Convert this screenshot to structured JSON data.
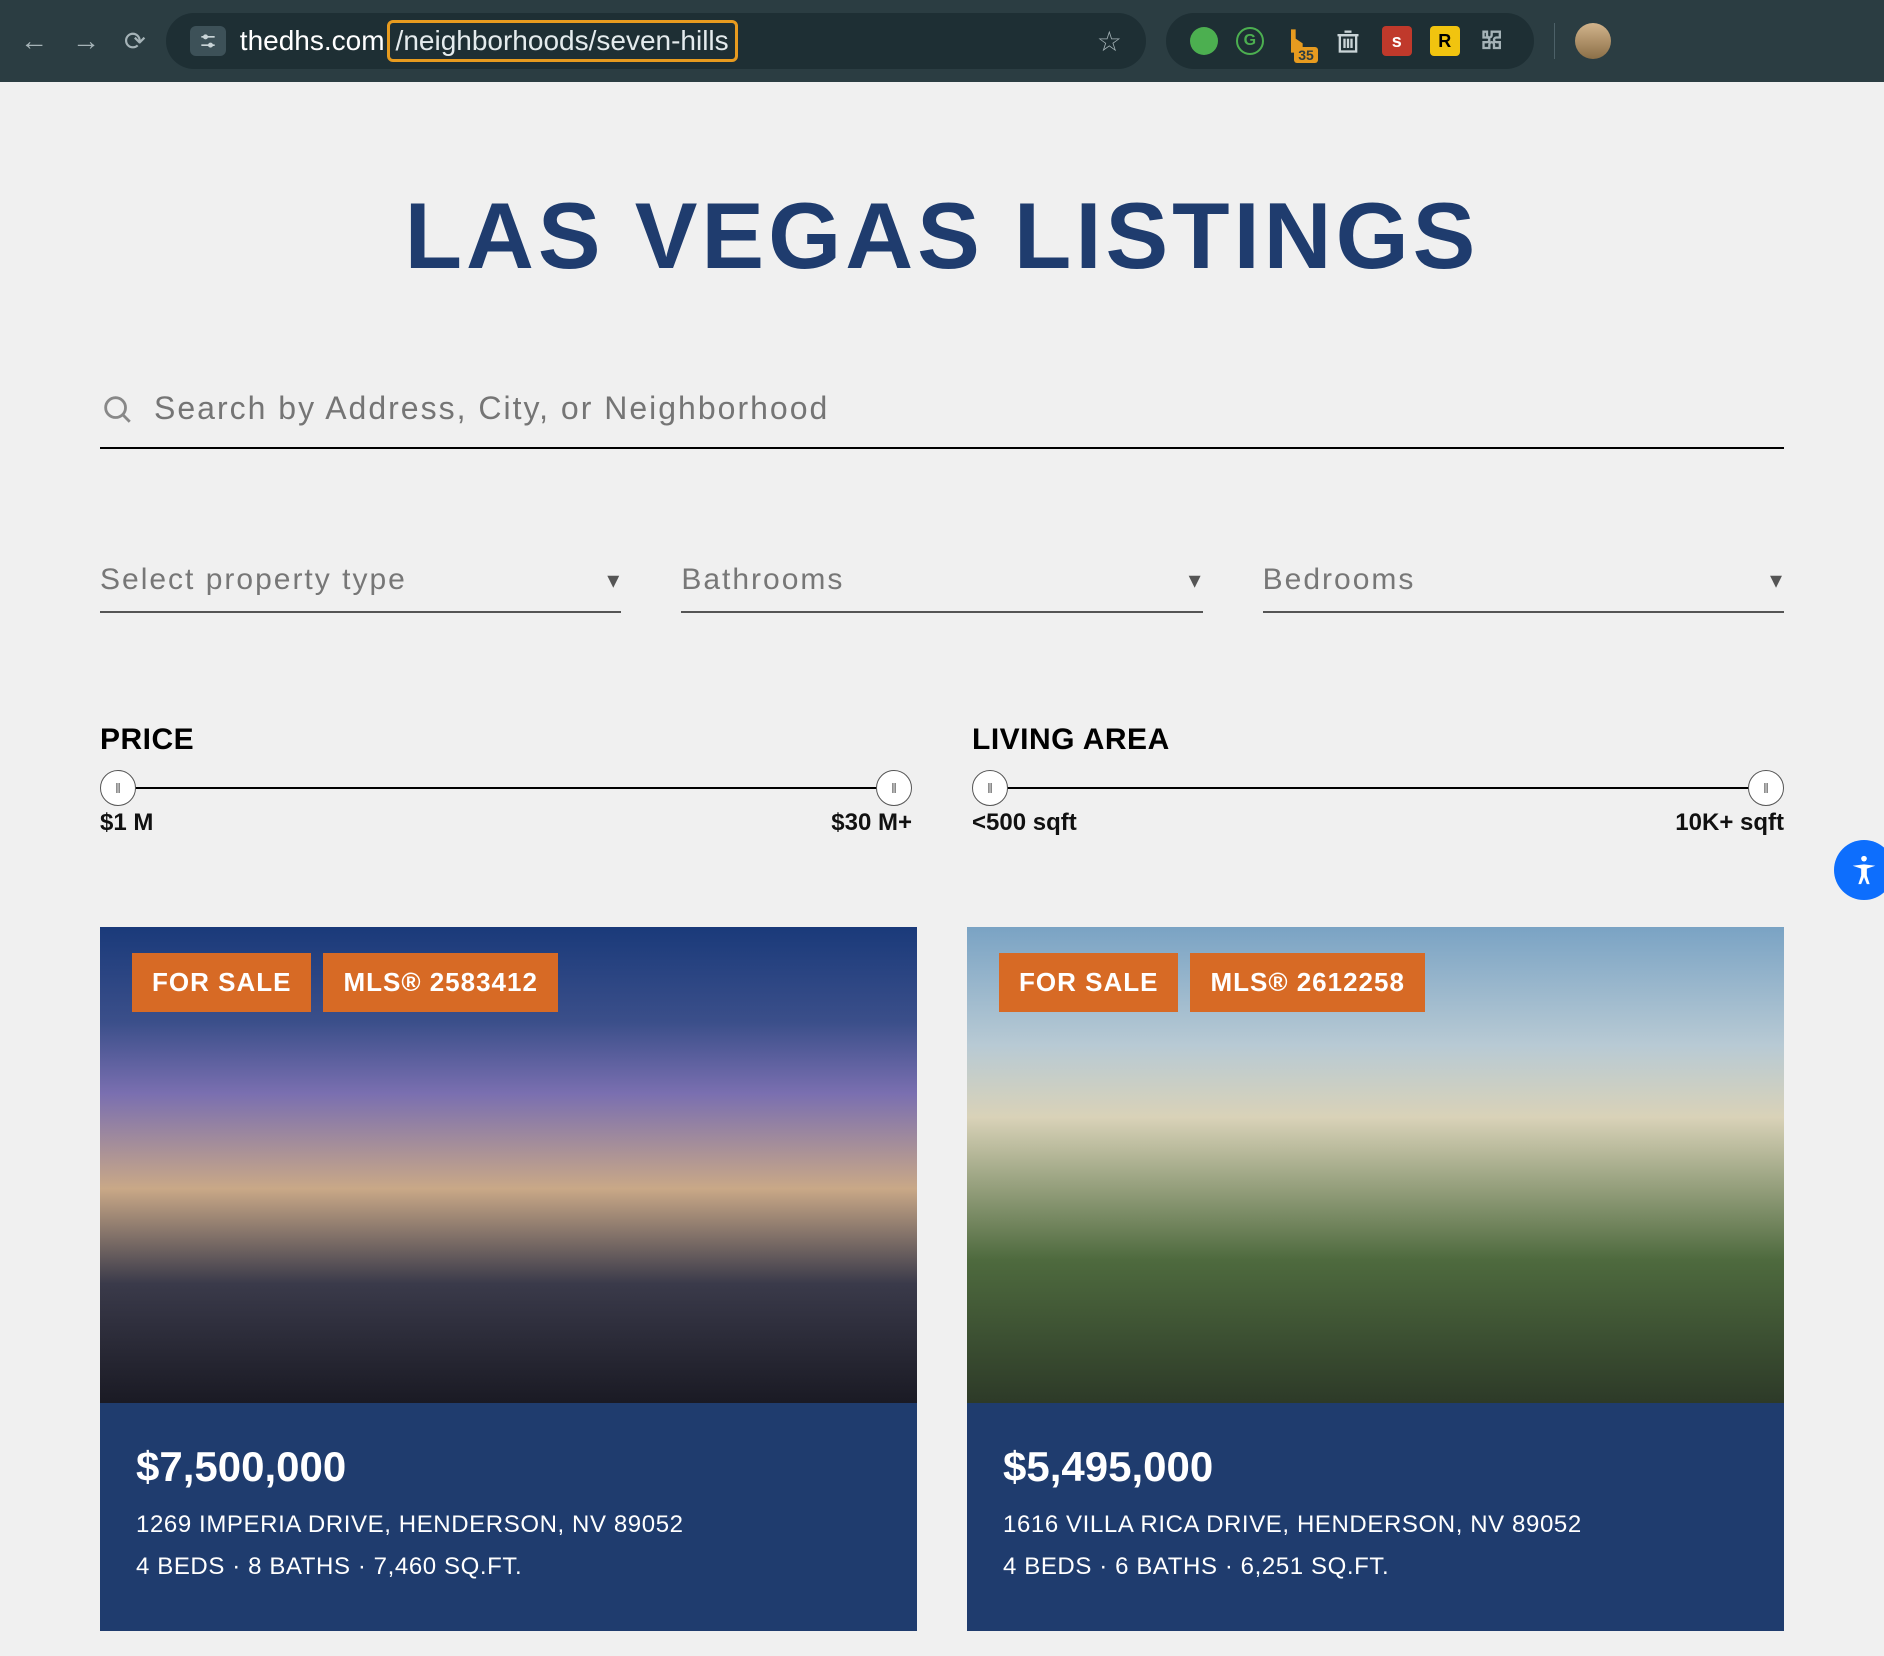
{
  "browser": {
    "url_domain": "thedhs.com",
    "url_path_highlighted": "/neighborhoods/seven-hills",
    "ext_badge": "35"
  },
  "page": {
    "title": "LAS VEGAS LISTINGS"
  },
  "search": {
    "placeholder": "Search by Address, City, or Neighborhood"
  },
  "filters": [
    {
      "label": "Select property type"
    },
    {
      "label": "Bathrooms"
    },
    {
      "label": "Bedrooms"
    }
  ],
  "sliders": {
    "price": {
      "title": "PRICE",
      "min_label": "$1 M",
      "max_label": "$30 M+"
    },
    "area": {
      "title": "LIVING AREA",
      "min_label": "<500 sqft",
      "max_label": "10K+ sqft"
    }
  },
  "listings": [
    {
      "status": "FOR SALE",
      "mls": "MLS® 2583412",
      "price": "$7,500,000",
      "address": "1269 IMPERIA DRIVE, HENDERSON, NV 89052",
      "meta": "4 BEDS · 8 BATHS · 7,460 SQ.FT."
    },
    {
      "status": "FOR SALE",
      "mls": "MLS® 2612258",
      "price": "$5,495,000",
      "address": "1616 VILLA RICA DRIVE, HENDERSON, NV 89052",
      "meta": "4 BEDS · 6 BATHS · 6,251 SQ.FT."
    }
  ]
}
